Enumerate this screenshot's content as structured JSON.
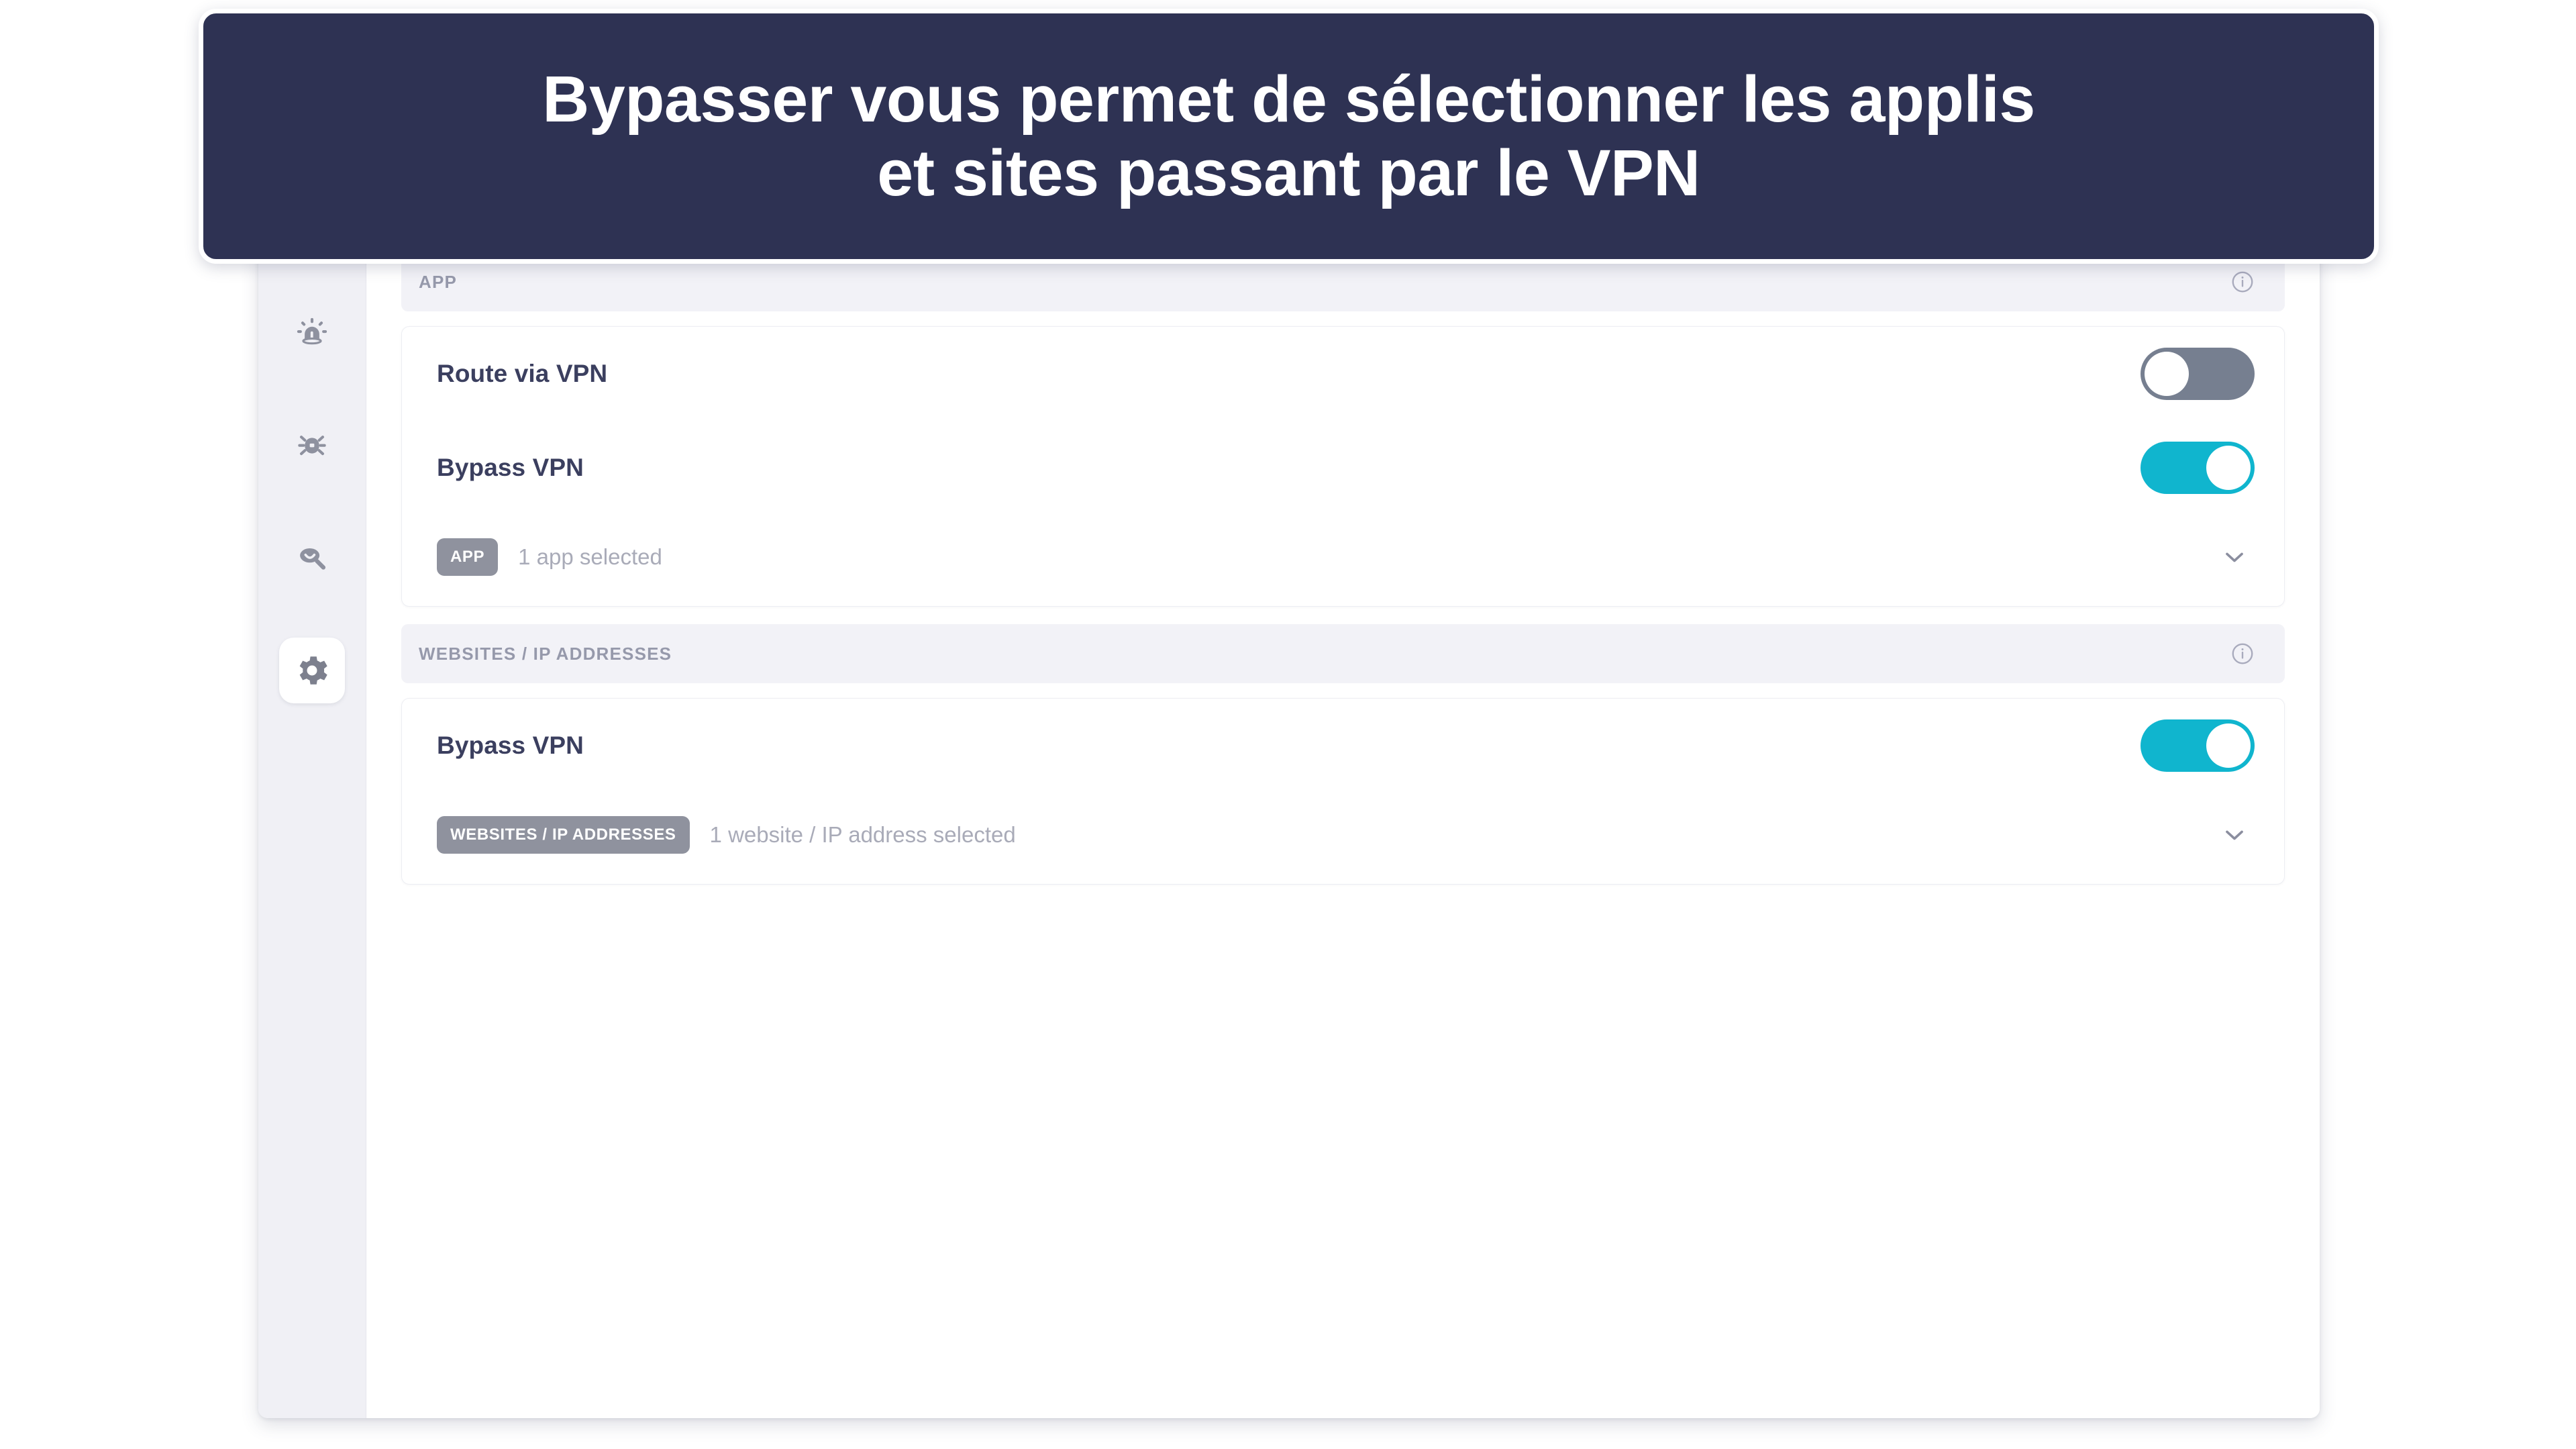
{
  "banner": {
    "line1": "Bypasser vous permet de sélectionner les applis",
    "line2": "et sites passant par le VPN",
    "background_color": "#2e3253",
    "text_color": "#ffffff"
  },
  "sidebar": {
    "items": [
      {
        "icon": "cloud-shield-icon",
        "active": false
      },
      {
        "icon": "alert-siren-icon",
        "active": false
      },
      {
        "icon": "bug-icon",
        "active": false
      },
      {
        "icon": "magnifier-icon",
        "active": false
      },
      {
        "icon": "gear-icon",
        "active": true
      }
    ]
  },
  "content": {
    "sections": [
      {
        "header_label": "APP",
        "info_icon": "info-circle-icon",
        "rows": [
          {
            "label": "Route via VPN",
            "toggle_state": "off"
          },
          {
            "label": "Bypass VPN",
            "toggle_state": "on"
          }
        ],
        "selection": {
          "badge": "APP",
          "text": "1 app selected",
          "chevron_icon": "chevron-down-icon"
        }
      },
      {
        "header_label": "WEBSITES / IP ADDRESSES",
        "info_icon": "info-circle-icon",
        "rows": [
          {
            "label": "Bypass VPN",
            "toggle_state": "on"
          }
        ],
        "selection": {
          "badge": "WEBSITES / IP ADDRESSES",
          "text": "1 website / IP address selected",
          "chevron_icon": "chevron-down-icon"
        }
      }
    ]
  },
  "colors": {
    "toggle_on": "#10b5ce",
    "toggle_off": "#767f90",
    "badge_gray": "#8f929e",
    "label_text": "#3b3f5f",
    "muted_text": "#a9abb8",
    "section_header_bg": "#f2f2f7",
    "sidebar_bg": "#f0f0f5"
  }
}
